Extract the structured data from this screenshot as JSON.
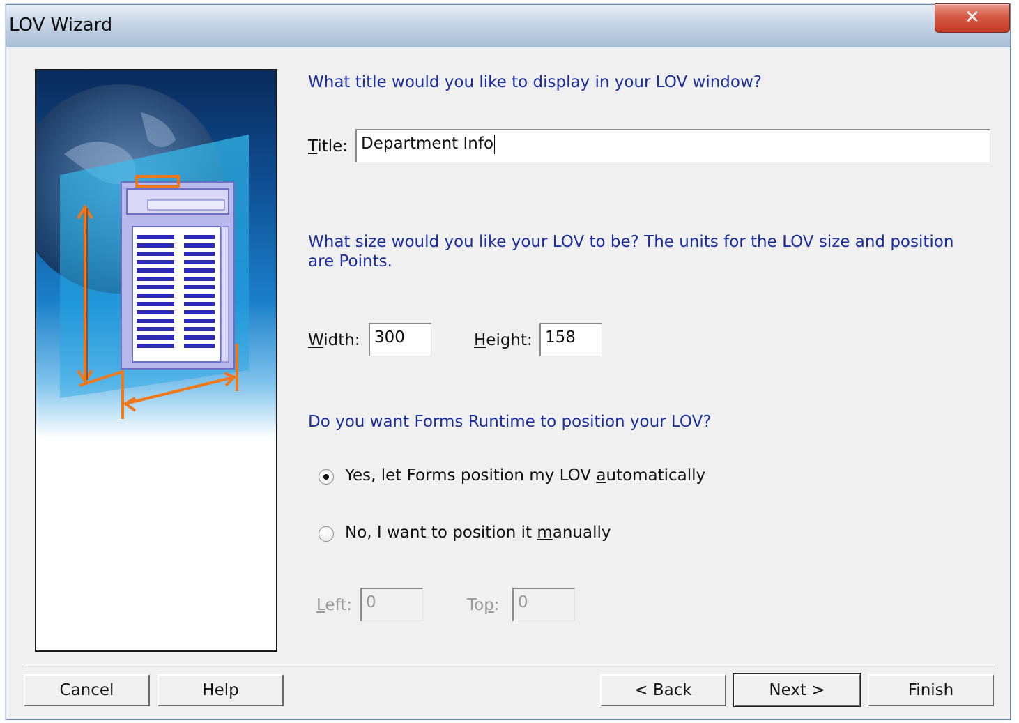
{
  "window": {
    "title": "LOV Wizard",
    "close_glyph": "✕"
  },
  "main": {
    "q_title": "What title would you like to display in your LOV window?",
    "title_label": "Title:",
    "title_value": "Department Info",
    "q_size": "What size would you like your LOV to be? The units for the LOV size and position are Points.",
    "width_label": "Width:",
    "width_value": "300",
    "height_label": "Height:",
    "height_value": "158",
    "q_position": "Do you want Forms Runtime to position your LOV?",
    "radio_auto_label": "Yes, let Forms position my LOV automatically",
    "radio_manual_label": "No, I want to position it manually",
    "selected_option": "auto",
    "left_label": "Left:",
    "left_value": "0",
    "top_label": "Top:",
    "top_value": "0"
  },
  "buttons": {
    "cancel": "Cancel",
    "help": "Help",
    "back": "< Back",
    "next": "Next >",
    "finish": "Finish"
  },
  "colors": {
    "question_text": "#1c2e9c",
    "window_bg": "#f0f0f0",
    "close_button": "#c23a25",
    "illustration_blue": "#1a6fc0",
    "illustration_orange": "#f07818"
  },
  "icons": {
    "close": "close-icon",
    "illustration": "lov-size-illustration"
  }
}
